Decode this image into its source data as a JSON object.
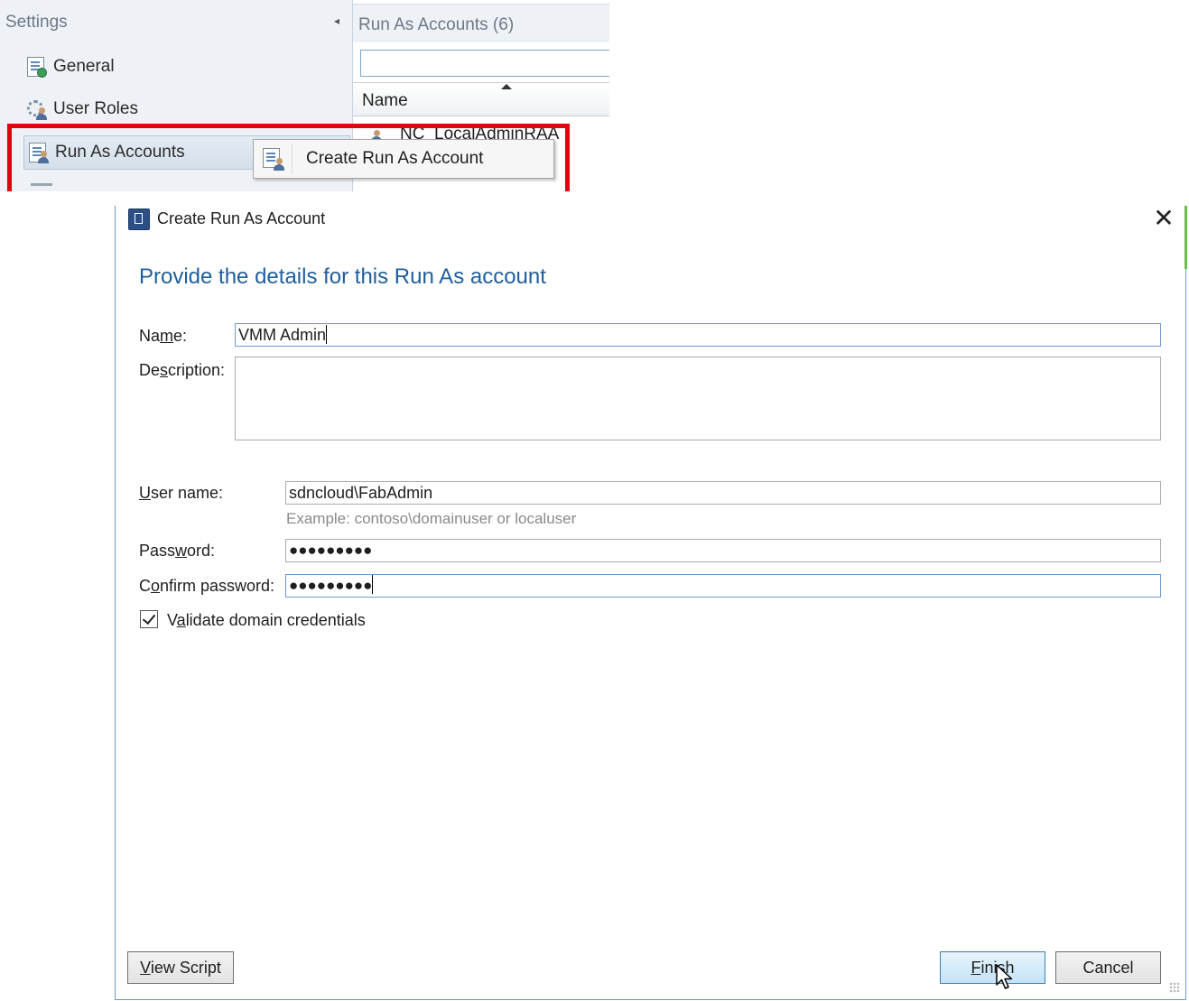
{
  "console": {
    "settings_title": "Settings",
    "nav_items": [
      {
        "label": "General",
        "icon": "settings-doc-icon"
      },
      {
        "label": "User Roles",
        "icon": "user-roles-icon"
      },
      {
        "label": "Run As Accounts",
        "icon": "run-as-accounts-icon"
      }
    ],
    "list_title": "Run As Accounts (6)",
    "filter_value": "",
    "column_header": "Name",
    "first_row": "NC_LocalAdminRAA",
    "context_menu": {
      "item_label": "Create Run As Account",
      "icon": "create-run-as-icon"
    },
    "highlight_color": "#e3000f"
  },
  "dialog": {
    "title": "Create Run As Account",
    "heading": "Provide the details for this Run As account",
    "name": {
      "label_pre": "Na",
      "label_key": "m",
      "label_post": "e:",
      "value": "VMM Admin"
    },
    "description": {
      "label_pre": "De",
      "label_key": "s",
      "label_post": "cription:",
      "value": ""
    },
    "username": {
      "label_pre": "",
      "label_key": "U",
      "label_post": "ser name:",
      "value": "sdncloud\\FabAdmin",
      "example": "Example: contoso\\domainuser or localuser"
    },
    "password": {
      "label_pre": "Pass",
      "label_key": "w",
      "label_post": "ord:",
      "value": "●●●●●●●●●"
    },
    "confirm_password": {
      "label_pre": "C",
      "label_key": "o",
      "label_post": "nfirm password:",
      "value": "●●●●●●●●●"
    },
    "validate": {
      "label_pre": "V",
      "label_key": "a",
      "label_post": "lidate domain credentials",
      "checked": true
    },
    "buttons": {
      "view_script": {
        "pre": "",
        "key": "V",
        "post": "iew Script"
      },
      "finish": {
        "pre": "",
        "key": "F",
        "post": "inish"
      },
      "cancel": {
        "label": "Cancel"
      }
    },
    "accent_color": "#1f5e9e"
  }
}
